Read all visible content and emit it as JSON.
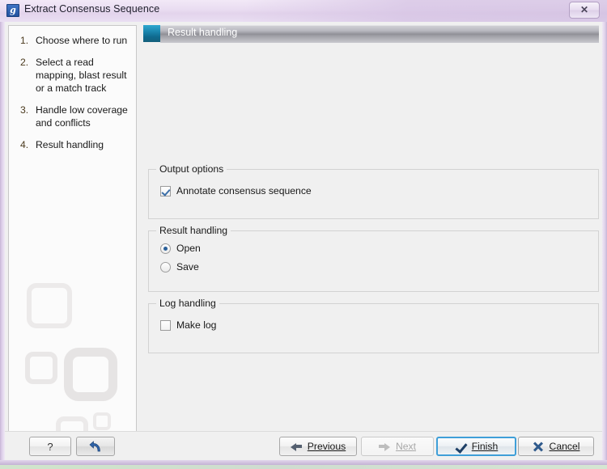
{
  "window": {
    "title": "Extract Consensus Sequence",
    "app_icon": "clc-genomics-icon",
    "close_label": "✕"
  },
  "sidebar": {
    "steps": [
      {
        "num": "1.",
        "label": "Choose where to run"
      },
      {
        "num": "2.",
        "label": "Select a read mapping, blast result or a match track"
      },
      {
        "num": "3.",
        "label": "Handle low coverage and conflicts"
      },
      {
        "num": "4.",
        "label": "Result handling"
      }
    ]
  },
  "banner": {
    "title": "Result handling"
  },
  "groups": {
    "output_options": {
      "legend": "Output options",
      "annotate": {
        "label": "Annotate consensus sequence",
        "checked": true
      }
    },
    "result_handling": {
      "legend": "Result handling",
      "open": {
        "label": "Open",
        "selected": true
      },
      "save": {
        "label": "Save",
        "selected": false
      }
    },
    "log_handling": {
      "legend": "Log handling",
      "make_log": {
        "label": "Make log",
        "checked": false
      }
    }
  },
  "buttons": {
    "help": "?",
    "reset": "reset-icon",
    "previous": "Previous",
    "next": "Next",
    "finish": "Finish",
    "cancel": "Cancel"
  },
  "colors": {
    "accent_teal": "#1a85ad",
    "focus_blue": "#3f9fd8",
    "radio_blue": "#2a6099",
    "check_blue": "#3c6fa8",
    "panel_bg": "#f0f0f0",
    "titlebar": "#e9dcf1"
  }
}
